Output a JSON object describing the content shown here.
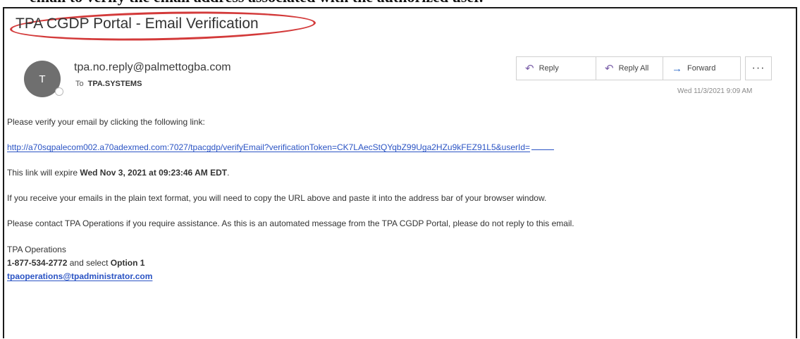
{
  "document": {
    "cropped_line": "email to verify the email address associated with the authorized user."
  },
  "email": {
    "subject": "TPA CGDP Portal - Email Verification",
    "avatar_initial": "T",
    "sender": "tpa.no.reply@palmettogba.com",
    "to_label": "To",
    "to_recipient": "TPA.SYSTEMS",
    "timestamp": "Wed 11/3/2021 9:09 AM",
    "actions": {
      "reply_label": "Reply",
      "reply_all_label": "Reply All",
      "forward_label": "Forward",
      "more_label": "···"
    },
    "icons": {
      "reply": "reply-arrow-icon",
      "reply_all": "reply-all-icon",
      "forward": "forward-arrow-icon",
      "more": "more-options-icon"
    },
    "body": {
      "intro": "Please verify your email by clicking the following link:",
      "verify_link": "http://a70sqpalecom002.a70adexmed.com:7027/tpacgdp/verifyEmail?verificationToken=CK7LAecStQYqbZ99Uga2HZu9kFEZ91L5&userId=",
      "expire_prefix": "This link will expire ",
      "expire_date": "Wed Nov 3, 2021 at 09:23:46 AM EDT",
      "expire_suffix": ".",
      "plain_text_note": "If you receive your emails in the plain text format, you will need to copy the URL above and paste it into the address bar of your browser window.",
      "contact_note": "Please contact TPA Operations if you require assistance. As this is an automated message from the TPA CGDP Portal, please do not reply to this email.",
      "signature_name": "TPA Operations",
      "phone": "1-877-534-2772",
      "phone_middle": " and select ",
      "option": "Option 1",
      "support_email": "tpaoperations@tpadministrator.com"
    }
  },
  "colors": {
    "highlight_oval": "#d33a3a",
    "link": "#2b54c4",
    "avatar_bg": "#6f6f6f"
  }
}
